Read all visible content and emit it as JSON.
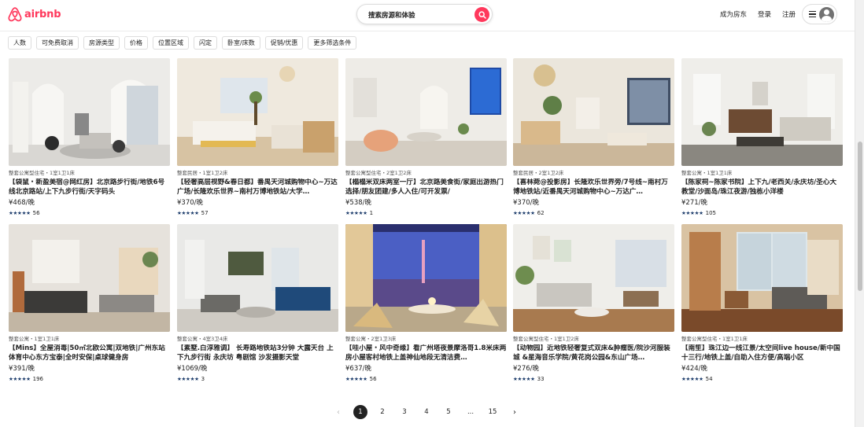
{
  "header": {
    "brand": "airbnb",
    "search_placeholder": "搜索房源和体验",
    "host_link": "成为房东",
    "login_link": "登录",
    "signup_link": "注册"
  },
  "filters": [
    "人数",
    "可免费取消",
    "房源类型",
    "价格",
    "位置区域",
    "闪定",
    "卧室/床数",
    "促销/优惠",
    "更多筛选条件"
  ],
  "listings": [
    {
      "type": "整套公寓型住宅・1室1卫1床",
      "title": "【袋鼠・新盈美宿@网红房】北京路步行街/地铁6号线北京路站/上下九步行街/天字码头",
      "price": "¥468/晚",
      "stars": "★★★★★",
      "reviews": "56"
    },
    {
      "type": "整套民居・1室1卫2床",
      "title": "【轻奢高层视野&春日都】番禺天河城购物中心~万达广场/长隆欢乐世界~南村万博地铁站/大学…",
      "price": "¥370/晚",
      "stars": "★★★★★",
      "reviews": "57"
    },
    {
      "type": "整套公寓型住宅・2室1卫2床",
      "title": "【榻榻米双床两室一厅】北京路美食街/家庭出游热门选择/朋友团建/多人入住/可开发票/",
      "price": "¥538/晚",
      "stars": "★★★★★",
      "reviews": "1"
    },
    {
      "type": "整套民居・2室1卫2床",
      "title": "【喜林菀@投影房】长隆欢乐世界旁/7号线~南村万博地铁站/近番禺天河城购物中心~万达广…",
      "price": "¥370/晚",
      "stars": "★★★★★",
      "reviews": "62"
    },
    {
      "type": "整套公寓・1室1卫1床",
      "title": "【陈家祠~陈家书院】上下九/老西关/永庆坊/圣心大教堂/沙面岛/珠江夜游/独栋小洋楼",
      "price": "¥271/晚",
      "stars": "★★★★★",
      "reviews": "105"
    },
    {
      "type": "整套公寓・1室1卫1床",
      "title": "【Mins】全屋消毒|50㎡北欧公寓|双地铁|广州东站体育中心东方宝泰|全时安保|桌球健身房",
      "price": "¥391/晚",
      "stars": "★★★★★",
      "reviews": "196"
    },
    {
      "type": "整套公寓・4室3卫4床",
      "title": "【素墅.白淳雅调】 长寿路地铁站3分钟 大露天台 上下九步行街 永庆坊 粤剧馆 沙发摄影天堂",
      "price": "¥1069/晚",
      "stars": "★★★★★",
      "reviews": "3"
    },
    {
      "type": "整套公寓・2室1卫3床",
      "title": "【哇小屋・风中奇缘】看广州塔夜景摩洛哥1.8米床两房小屋客村地铁上盖神仙地段无清洁费…",
      "price": "¥637/晚",
      "stars": "★★★★★",
      "reviews": "56"
    },
    {
      "type": "整套公寓型住宅・1室1卫2床",
      "title": "【动物园】近地铁轻奢复式双床&肿瘤医/院沙河服装城 &星海音乐学院/黄花岗公园&东山广场…",
      "price": "¥276/晚",
      "stars": "★★★★★",
      "reviews": "33"
    },
    {
      "type": "整套公寓型住宅・1室1卫1床",
      "title": "【南笙】珠江边一线江景/太空间live house/新中国十三行/地铁上盖/自助入住方便/高端小区",
      "price": "¥424/晚",
      "stars": "★★★★★",
      "reviews": "54"
    }
  ],
  "pagination": {
    "prev": "‹",
    "pages": [
      "1",
      "2",
      "3",
      "4",
      "5",
      "...",
      "15"
    ],
    "next": "›",
    "current": "1"
  },
  "colors": {
    "brand": "#ff385c",
    "stars": "#1a3a6a"
  }
}
